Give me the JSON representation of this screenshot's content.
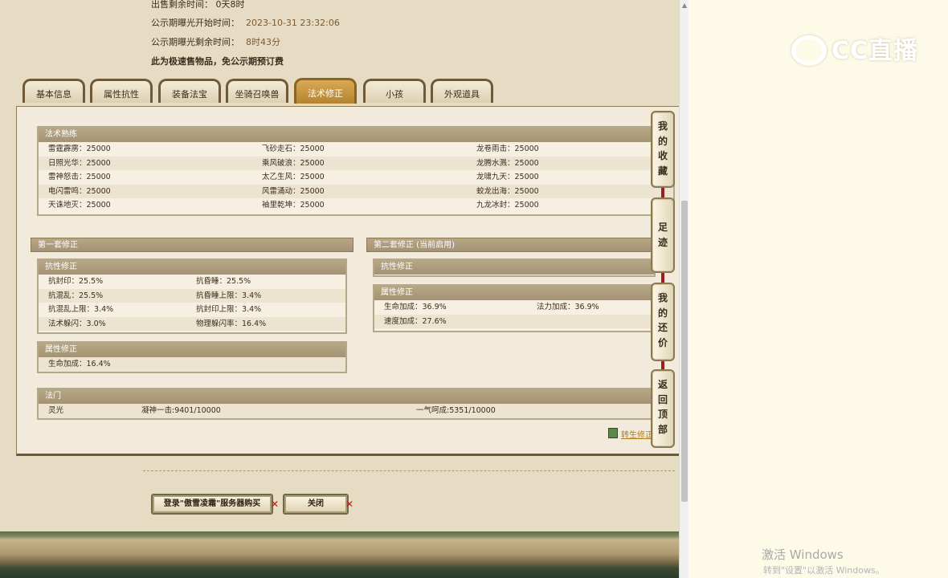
{
  "info": {
    "top_partial": "出售剩余时间： 0天8时",
    "exposure_start_label": "公示期曝光开始时间：",
    "exposure_start_value": "2023-10-31 23:32:06",
    "exposure_remaining_label": "公示期曝光剩余时间：",
    "exposure_remaining_value": "8时43分",
    "fast_sale_note": "此为极速售物品，免公示期预订费"
  },
  "tabs": [
    {
      "label": "基本信息",
      "active": false
    },
    {
      "label": "属性抗性",
      "active": false
    },
    {
      "label": "装备法宝",
      "active": false
    },
    {
      "label": "坐骑召唤兽",
      "active": false
    },
    {
      "label": "法术修正",
      "active": true
    },
    {
      "label": "小孩",
      "active": false
    },
    {
      "label": "外观道具",
      "active": false
    }
  ],
  "spell_mastery": {
    "title": "法术熟练",
    "rows": [
      [
        "雷霆霹雳：25000",
        "飞砂走石：25000",
        "龙卷雨击：25000"
      ],
      [
        "日照光华：25000",
        "乘风破浪：25000",
        "龙腾水溅：25000"
      ],
      [
        "雷神怒击：25000",
        "太乙生风：25000",
        "龙啸九天：25000"
      ],
      [
        "电闪雷鸣：25000",
        "风雷涌动：25000",
        "蛟龙出海：25000"
      ],
      [
        "天诛地灭：25000",
        "袖里乾坤：25000",
        "九龙冰封：25000"
      ]
    ]
  },
  "set1": {
    "title": "第一套修正",
    "resist": {
      "title": "抗性修正",
      "rows": [
        [
          "抗封印：25.5%",
          "抗昏睡：25.5%"
        ],
        [
          "抗混乱：25.5%",
          "抗昏睡上限：3.4%"
        ],
        [
          "抗混乱上限：3.4%",
          "抗封印上限：3.4%"
        ],
        [
          "法术躲闪：3.0%",
          "物理躲闪率：16.4%"
        ]
      ]
    },
    "attr": {
      "title": "属性修正",
      "rows": [
        [
          "生命加成：16.4%"
        ]
      ]
    }
  },
  "set2": {
    "title": "第二套修正 (当前启用)",
    "resist": {
      "title": "抗性修正"
    },
    "attr": {
      "title": "属性修正",
      "rows": [
        [
          "生命加成：36.9%",
          "法力加成：36.9%"
        ],
        [
          "速度加成：27.6%",
          ""
        ]
      ]
    }
  },
  "school": {
    "title": "法门",
    "row": [
      "灵光",
      "凝神一击:9401/10000",
      "一气呵成:5351/10000"
    ]
  },
  "calc_link": "转生修正",
  "side_buttons": [
    "我的收藏",
    "足迹",
    "我的还价",
    "返回顶部"
  ],
  "actions": {
    "login_buy": "登录\"傲雪凌霜\"服务器购买",
    "close": "关闭",
    "x_mark": "✕"
  },
  "logo": {
    "text": "CC直播"
  },
  "watermark": {
    "title": "激活 Windows",
    "subtitle": "转到\"设置\"以激活 Windows。"
  },
  "colors": {
    "page_bg": "#e6dcc4",
    "panel_bg": "#f2ebdb",
    "header_bar": "#a49374",
    "active_tab": "#c4923e",
    "date_value": "#7a5a30",
    "link": "#b07a20"
  }
}
